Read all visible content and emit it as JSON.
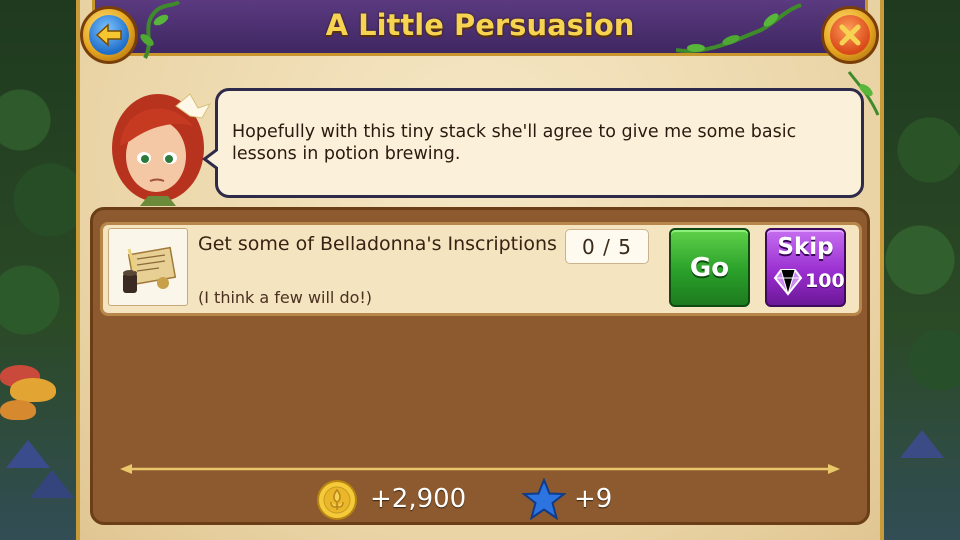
{
  "title": "A Little Persuasion",
  "dialog": {
    "text": "Hopefully with this tiny stack she'll agree to give me some basic lessons in potion brewing."
  },
  "quest": {
    "title": "Get some of Belladonna's Inscriptions",
    "subtitle": "(I think a few will do!)",
    "progress": "0 / 5",
    "go_label": "Go",
    "skip_label": "Skip",
    "skip_cost": "100"
  },
  "rewards": {
    "coins": "+2,900",
    "stars": "+9"
  },
  "icons": {
    "back": "back-arrow-icon",
    "close": "close-x-icon",
    "coin": "coin-icon",
    "star": "star-icon",
    "gem": "gem-icon",
    "quest": "scroll-icon"
  },
  "colors": {
    "title_bar": "#4b2f70",
    "title_text": "#f7d352",
    "go_button": "#2aa02a",
    "skip_button": "#9a2fd0",
    "list_bg": "#8c5a2e"
  }
}
